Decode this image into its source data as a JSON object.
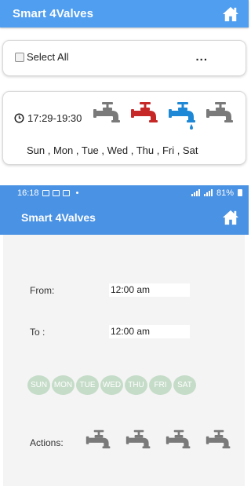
{
  "top": {
    "title": "Smart 4Valves",
    "select_all_label": "Select All",
    "more_label": "...",
    "schedule": {
      "time_range": "17:29-19:30",
      "days": "Sun , Mon , Tue , Wed , Thu , Fri , Sat",
      "valves": [
        {
          "state": "off",
          "color": "#7a7a7a"
        },
        {
          "state": "on-red",
          "color": "#c62828"
        },
        {
          "state": "on-blue",
          "color": "#1f88d6"
        },
        {
          "state": "off",
          "color": "#7a7a7a"
        }
      ]
    }
  },
  "status": {
    "time": "16:18",
    "battery": "81%"
  },
  "form": {
    "title": "Smart 4Valves",
    "from_label": "From:",
    "from_value": "12:00 am",
    "to_label": "To :",
    "to_value": "12:00 am",
    "days": [
      "SUN",
      "MON",
      "TUE",
      "WED",
      "THU",
      "FRI",
      "SAT"
    ],
    "actions_label": "Actions:",
    "actions": [
      "valve-1",
      "valve-2",
      "valve-3",
      "valve-4"
    ]
  },
  "colors": {
    "appbar": "#4f9ef0",
    "day_circle": "#c5dcc8",
    "valve_gray": "#7a7a7a"
  }
}
